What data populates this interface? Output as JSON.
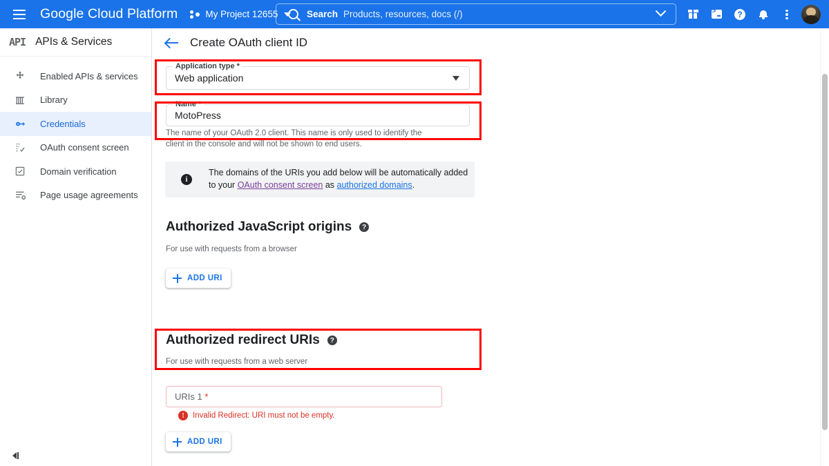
{
  "topbar": {
    "menu_icon": "hamburger-menu-icon",
    "brand": "Google Cloud Platform",
    "project_name": "My Project 12655",
    "project_icon": "project-selector-icon",
    "search": {
      "icon": "search-icon",
      "label": "Search",
      "placeholder": "Products, resources, docs (/)",
      "expand_icon": "chevron-down-icon"
    },
    "icons": [
      {
        "name": "gift-icon",
        "label": "What's new"
      },
      {
        "name": "cloud-shell-icon",
        "label": "Activate Cloud Shell"
      },
      {
        "name": "help-icon",
        "label": "Support"
      },
      {
        "name": "notifications-bell-icon",
        "label": "Notifications"
      },
      {
        "name": "kebab-menu-icon",
        "label": "More options"
      }
    ],
    "avatar": "user-avatar"
  },
  "sidebar": {
    "logo_text": "API",
    "title": "APIs & Services",
    "items": [
      {
        "label": "Enabled APIs & services",
        "icon": "enabled-apis-icon",
        "active": false
      },
      {
        "label": "Library",
        "icon": "library-icon",
        "active": false
      },
      {
        "label": "Credentials",
        "icon": "key-icon",
        "active": true
      },
      {
        "label": "OAuth consent screen",
        "icon": "consent-screen-icon",
        "active": false
      },
      {
        "label": "Domain verification",
        "icon": "domain-verification-icon",
        "active": false
      },
      {
        "label": "Page usage agreements",
        "icon": "page-usage-agreements-icon",
        "active": false
      }
    ],
    "collapse_label": "Collapse navigation"
  },
  "page": {
    "back_icon": "back-arrow-icon",
    "title": "Create OAuth client ID"
  },
  "form": {
    "application_type": {
      "label": "Application type *",
      "value": "Web application",
      "dropdown_icon": "dropdown-caret-icon"
    },
    "name": {
      "label": "Name *",
      "value": "MotoPress",
      "helper": "The name of your OAuth 2.0 client. This name is only used to identify the client in the console and will not be shown to end users."
    }
  },
  "info_banner": {
    "icon": "info-icon",
    "text_part1": "The domains of the URIs you add below will be automatically added to your ",
    "link1": "OAuth consent screen",
    "text_part2": " as ",
    "link2": "authorized domains",
    "text_part3": "."
  },
  "js_origins": {
    "title": "Authorized JavaScript origins",
    "help_icon": "help-circle-icon",
    "subtitle": "For use with requests from a browser",
    "add_button": "ADD URI",
    "add_icon": "plus-icon"
  },
  "redirect_uris": {
    "title": "Authorized redirect URIs",
    "help_icon": "help-circle-icon",
    "subtitle": "For use with requests from a web server",
    "uri_placeholder": "URIs 1",
    "uri_required_mark": "*",
    "uri_value": "",
    "error_icon": "error-icon",
    "error_message": "Invalid Redirect: URI must not be empty.",
    "add_button": "ADD URI",
    "add_icon": "plus-icon"
  },
  "annotations": {
    "highlight_color": "#ff0000",
    "boxes": [
      {
        "name": "application-type-highlight"
      },
      {
        "name": "name-field-highlight"
      },
      {
        "name": "redirect-uris-highlight"
      }
    ]
  },
  "colors": {
    "brand_blue": "#1a73e8",
    "active_nav_bg": "#e8f0fe",
    "error_red": "#d93025",
    "link_visited": "#7b3f9d"
  }
}
